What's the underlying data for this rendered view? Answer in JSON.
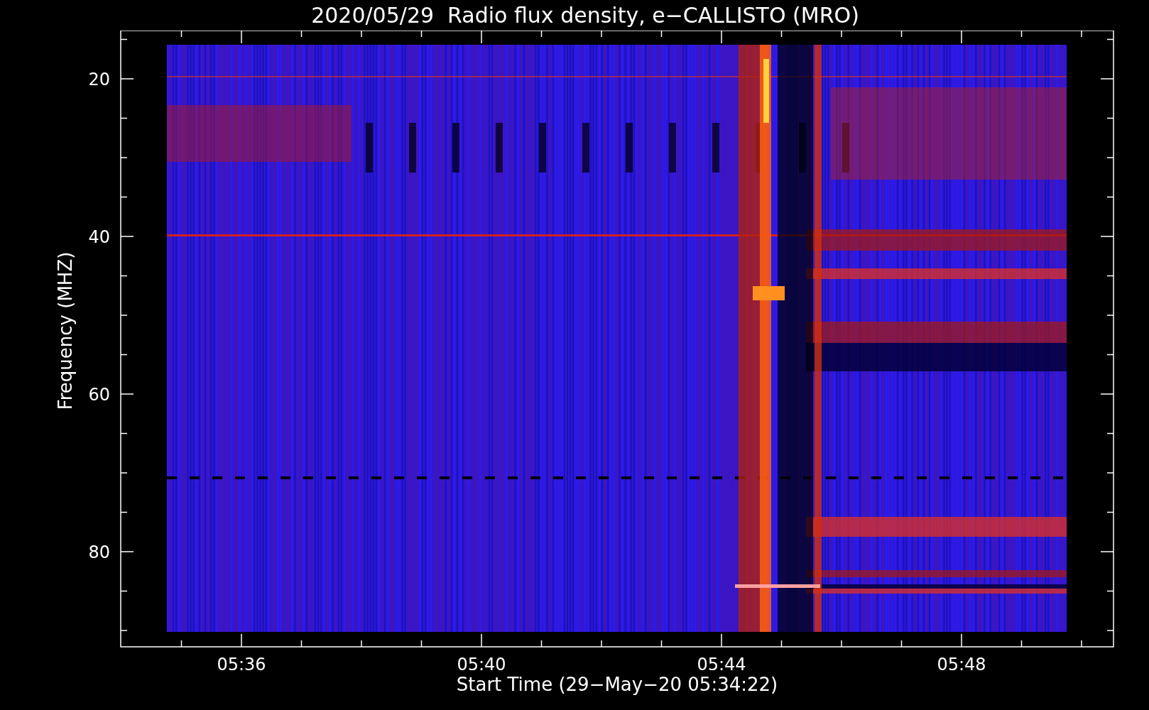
{
  "title": "2020/05/29  Radio flux density, e−CALLISTO (MRO)",
  "y_axis": {
    "label": "Frequency (MHZ)",
    "ticks": [
      "20",
      "40",
      "60",
      "80"
    ]
  },
  "x_axis": {
    "label": "Start Time (29−May−20 05:34:22)",
    "ticks": [
      "05:36",
      "05:40",
      "05:44",
      "05:48"
    ]
  }
}
